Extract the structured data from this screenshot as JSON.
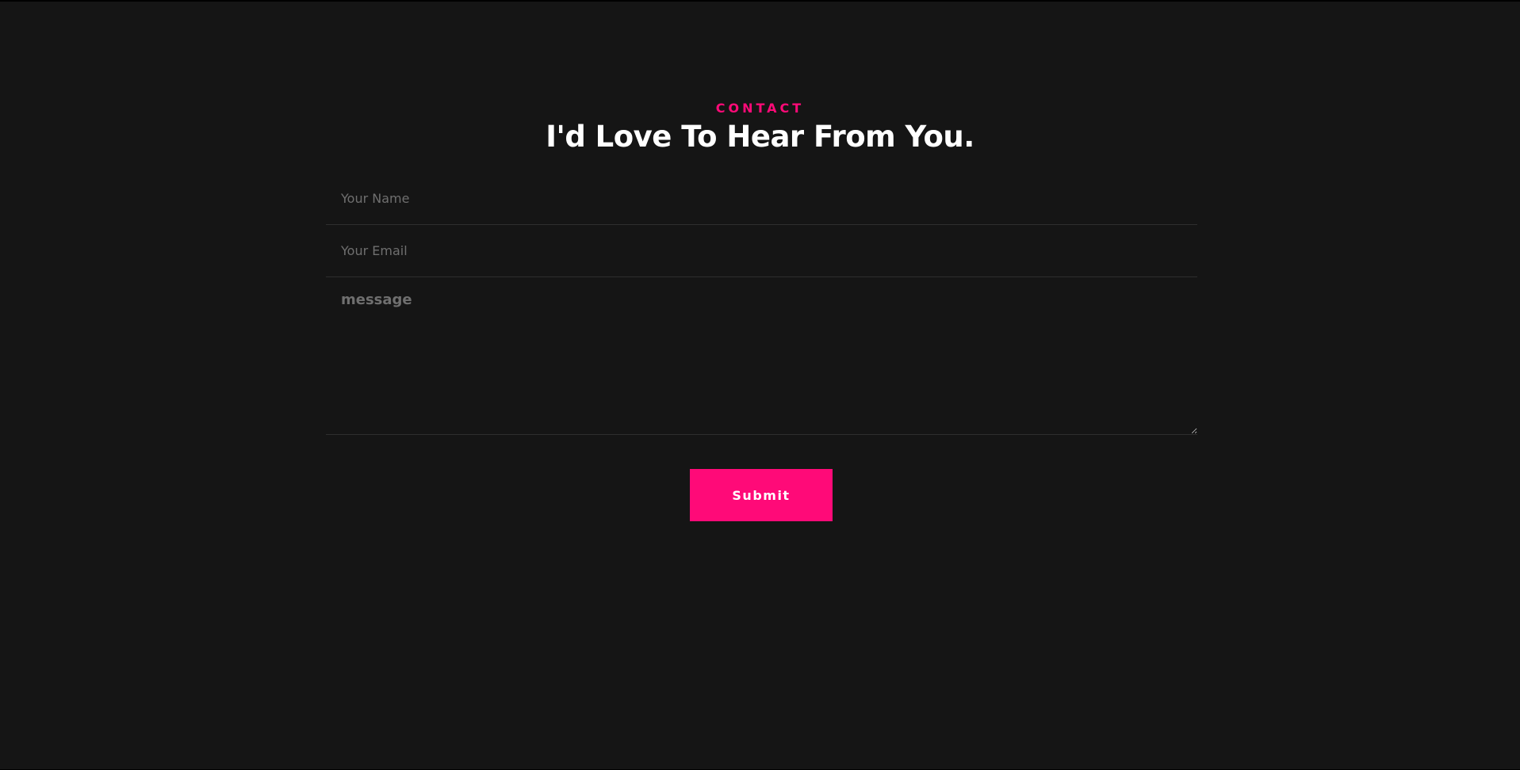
{
  "section": {
    "eyebrow": "CONTACT",
    "title": "I'd Love To Hear From You."
  },
  "form": {
    "name": {
      "value": "",
      "placeholder": "Your Name"
    },
    "email": {
      "value": "",
      "placeholder": "Your Email"
    },
    "message": {
      "value": "",
      "placeholder": "message"
    },
    "submit_label": "Submit"
  },
  "colors": {
    "accent": "#ff0a78",
    "background": "#151515",
    "title": "#ffffff",
    "placeholder": "#6f6f6f",
    "divider": "#2e2e2e"
  }
}
